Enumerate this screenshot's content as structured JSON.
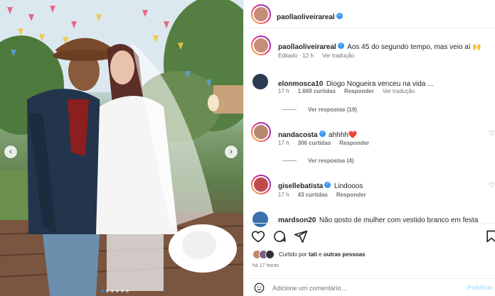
{
  "post": {
    "author": "paollaoliveirareal",
    "caption_author": "paollaoliveirareal",
    "caption": "Aos 45 do segundo tempo, mas veio aí 🙌",
    "caption_edited": "Editado",
    "caption_time": "12 h",
    "caption_translate": "Ver tradução"
  },
  "comments": [
    {
      "username": "elonmosca10",
      "verified": false,
      "text": "Diogo Nogueira venceu na vida ...",
      "time": "17 h",
      "likes": "1.669 curtidas",
      "reply": "Responder",
      "translate": "Ver tradução",
      "replies_label": "Ver respostas (19)"
    },
    {
      "username": "nandacosta",
      "verified": true,
      "text": "ahhhh❤️",
      "time": "17 h",
      "likes": "306 curtidas",
      "reply": "Responder",
      "replies_label": "Ver respostas (4)"
    },
    {
      "username": "gisellebatista",
      "verified": true,
      "text": "Lindooos",
      "time": "17 h",
      "likes": "43 curtidas",
      "reply": "Responder"
    },
    {
      "username": "mardson20",
      "verified": false,
      "text": "Não gosto de mulher com vestido branco em festa"
    }
  ],
  "likes_line": {
    "prefix": "Curtido por",
    "user": "tati",
    "connector": "e",
    "others": "outras pessoas"
  },
  "time_ago": "há 17 horas",
  "comment_input": {
    "placeholder": "Adicione um comentário...",
    "publish": "Publicar"
  },
  "icons": {
    "like": "heart-icon",
    "comment": "comment-icon",
    "share": "send-icon",
    "save": "bookmark-icon",
    "emoji": "emoji-icon",
    "prev": "chevron-left-icon",
    "next": "chevron-right-icon"
  },
  "colors": {
    "verified": "#3897f0",
    "link": "#737373",
    "publish": "#b2dffc"
  },
  "carousel": {
    "count": 6,
    "active": 0
  }
}
